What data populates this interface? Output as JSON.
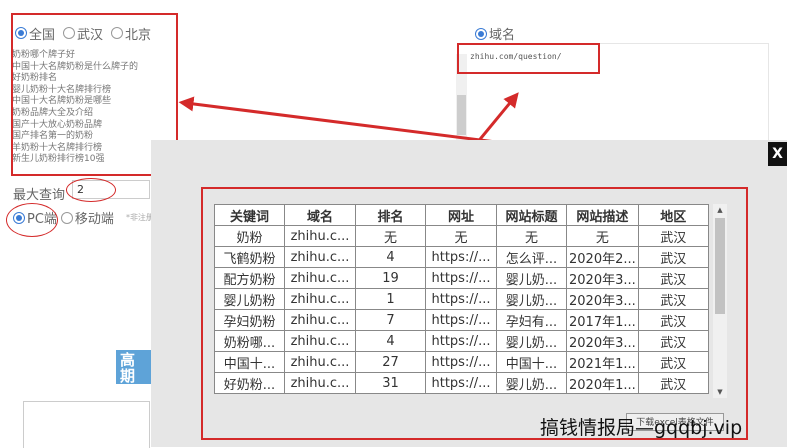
{
  "region_options": [
    {
      "label": "全国",
      "selected": true
    },
    {
      "label": "武汉",
      "selected": false
    },
    {
      "label": "北京",
      "selected": false
    }
  ],
  "keywords": [
    "奶粉哪个牌子好",
    "中国十大名牌奶粉是什么牌子的",
    "好奶粉排名",
    "婴儿奶粉十大名牌排行榜",
    "中国十大名牌奶粉是哪些",
    "奶粉品牌大全及介绍",
    "国产十大放心奶粉品牌",
    "国产排名第一的奶粉",
    "羊奶粉十大名牌排行榜",
    "新生儿奶粉排行榜10强"
  ],
  "domain_option": {
    "label": "域名",
    "selected": true
  },
  "url_value": "zhihu.com/question/",
  "max_query": {
    "label": "最大查询",
    "value": "2"
  },
  "platform_options": [
    {
      "label": "PC端",
      "selected": true
    },
    {
      "label": "移动端",
      "selected": false
    }
  ],
  "platform_note": "*非注册",
  "banner_text": "高 期",
  "close_label": "X",
  "table": {
    "headers": [
      "关键词",
      "域名",
      "排名",
      "网址",
      "网站标题",
      "网站描述",
      "地区"
    ],
    "rows": [
      [
        "奶粉",
        "zhihu.c...",
        "无",
        "无",
        "无",
        "无",
        "武汉"
      ],
      [
        "飞鹤奶粉",
        "zhihu.c...",
        "4",
        "https://...",
        "怎么评...",
        "2020年2...",
        "武汉"
      ],
      [
        "配方奶粉",
        "zhihu.c...",
        "19",
        "https://...",
        "婴儿奶...",
        "2020年3...",
        "武汉"
      ],
      [
        "婴儿奶粉",
        "zhihu.c...",
        "1",
        "https://...",
        "婴儿奶...",
        "2020年3...",
        "武汉"
      ],
      [
        "孕妇奶粉",
        "zhihu.c...",
        "7",
        "https://...",
        "孕妇有...",
        "2017年1...",
        "武汉"
      ],
      [
        "奶粉哪...",
        "zhihu.c...",
        "4",
        "https://...",
        "婴儿奶...",
        "2020年3...",
        "武汉"
      ],
      [
        "中国十...",
        "zhihu.c...",
        "27",
        "https://...",
        "中国十...",
        "2021年1...",
        "武汉"
      ],
      [
        "好奶粉...",
        "zhihu.c...",
        "31",
        "https://...",
        "婴儿奶...",
        "2020年1...",
        "武汉"
      ]
    ]
  },
  "export_label": "下载excel表格文件",
  "watermark": "搞钱情报局—gqqbj.vip",
  "colors": {
    "annotation_red": "#d42a2a",
    "radio_blue": "#3a7bd5",
    "banner_blue": "#5ea3d8"
  },
  "icons": {
    "close": "close-icon",
    "scroll_up": "chevron-up-icon",
    "scroll_down": "chevron-down-icon",
    "annotation": "red-arrow"
  }
}
